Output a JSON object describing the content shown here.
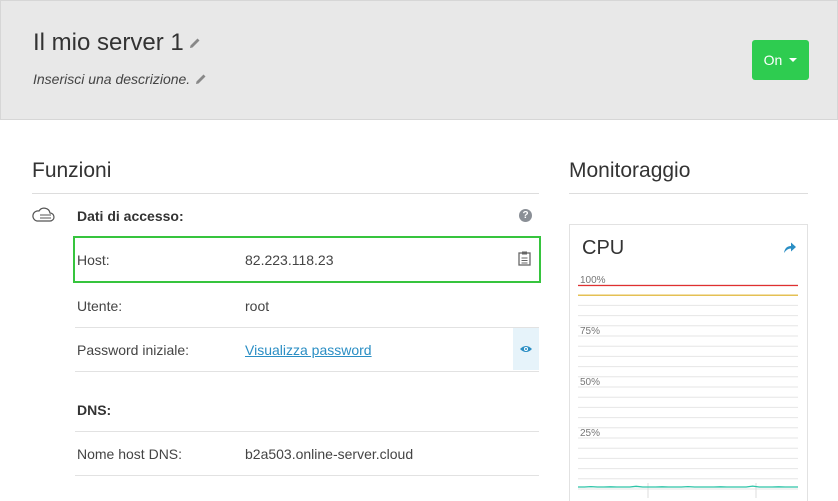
{
  "header": {
    "title": "Il mio server 1",
    "description": "Inserisci una descrizione.",
    "power_button": "On"
  },
  "funzioni": {
    "title": "Funzioni",
    "access": {
      "heading": "Dati di accesso:",
      "host_label": "Host:",
      "host_value": "82.223.118.23",
      "user_label": "Utente:",
      "user_value": "root",
      "password_label": "Password iniziale:",
      "password_link": "Visualizza password"
    },
    "dns": {
      "heading": "DNS:",
      "hostname_label": "Nome host DNS:",
      "hostname_value": "b2a503.online-server.cloud"
    }
  },
  "monitoraggio": {
    "title": "Monitoraggio",
    "cpu_title": "CPU"
  },
  "chart_data": {
    "type": "line",
    "title": "CPU",
    "ylim": [
      0,
      100
    ],
    "yticks": [
      "100%",
      "75%",
      "50%",
      "25%"
    ],
    "grid": true,
    "thresholds": [
      {
        "value": 100,
        "color": "#e03030"
      },
      {
        "value": 95,
        "color": "#e0b020"
      }
    ],
    "series": [
      {
        "color": "#2ec4a8",
        "values": [
          1,
          1,
          1.2,
          1,
          1,
          1.1,
          1,
          1,
          1,
          1.3,
          1,
          1,
          1,
          1.1,
          1,
          1,
          1,
          1.2,
          1,
          1,
          1,
          1,
          1.1,
          1,
          1,
          1,
          1,
          1.4,
          1,
          1,
          1,
          1.1,
          1,
          1,
          1
        ]
      }
    ]
  },
  "colors": {
    "accent_green": "#2ecc50",
    "host_highlight": "#36c43e",
    "link_blue": "#2a8ec4"
  },
  "icons": {
    "edit": "pencil-icon",
    "cloud": "cloud-icon",
    "help": "question-icon",
    "copy": "clipboard-icon",
    "reveal": "eye-icon",
    "share": "share-arrow-icon"
  }
}
